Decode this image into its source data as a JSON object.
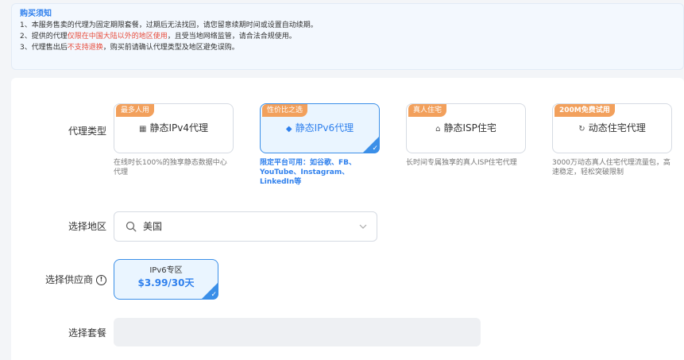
{
  "notice": {
    "title": "购买须知",
    "line1": "1、本服务售卖的代理为固定期限套餐，过期后无法找回，请您留意续期时间或设置自动续期。",
    "line2_prefix": "2、提供的代理",
    "line2_red": "仅限在中国大陆以外的地区使用",
    "line2_suffix": "，且受当地网络监管，请合法合规使用。",
    "line3_prefix": "3、代理售出后",
    "line3_red": "不支持退换",
    "line3_suffix": "，购买前请确认代理类型及地区避免误购。"
  },
  "labels": {
    "proxy_type": "代理类型",
    "region": "选择地区",
    "supplier": "选择供应商",
    "plan": "选择套餐"
  },
  "proxy_types": [
    {
      "tag": "最多人用",
      "icon": "server-icon",
      "name": "静态IPv4代理",
      "desc": "在线时长100%的独享静态数据中心代理",
      "selected": false
    },
    {
      "tag": "性价比之选",
      "icon": "layers-icon",
      "name": "静态IPv6代理",
      "desc": "限定平台可用：如谷歌、FB、YouTube、Instagram、LinkedIn等",
      "selected": true
    },
    {
      "tag": "真人住宅",
      "icon": "home-icon",
      "name": "静态ISP住宅",
      "desc": "长时间专属独享的真人ISP住宅代理",
      "selected": false
    },
    {
      "tag": "200M免费试用",
      "icon": "refresh-icon",
      "name": "动态住宅代理",
      "desc": "3000万动态真人住宅代理流量包，高速稳定，轻松突破限制",
      "selected": false
    }
  ],
  "region": {
    "value": "美国"
  },
  "supplier": {
    "name": "IPv6专区",
    "price": "$3.99/30天"
  },
  "colors": {
    "accent": "#2f80ed",
    "tag": "#f2a05c",
    "warning": "#e74c3c"
  }
}
